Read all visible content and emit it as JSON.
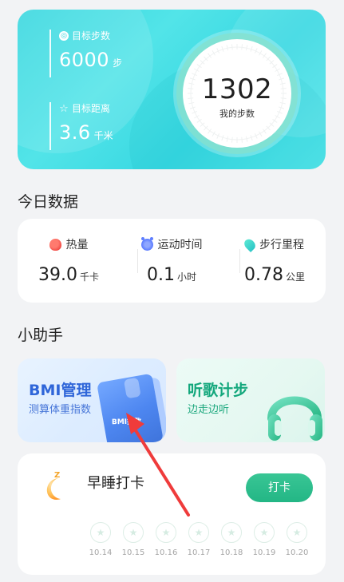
{
  "hero": {
    "goal_steps_label": "目标步数",
    "goal_steps_value": "6000",
    "goal_steps_unit": "步",
    "goal_distance_label": "目标距离",
    "goal_distance_value": "3.6",
    "goal_distance_unit": "千米",
    "current_steps": "1302",
    "current_steps_label": "我的步数"
  },
  "today": {
    "title": "今日数据",
    "metrics": [
      {
        "label": "热量",
        "value": "39.0",
        "unit": "千卡"
      },
      {
        "label": "运动时间",
        "value": "0.1",
        "unit": "小时"
      },
      {
        "label": "步行里程",
        "value": "0.78",
        "unit": "公里"
      }
    ]
  },
  "helper": {
    "title": "小助手",
    "cards": [
      {
        "title": "BMI管理",
        "subtitle": "测算体重指数",
        "illustration_text": "BMI指数"
      },
      {
        "title": "听歌计步",
        "subtitle": "边走边听"
      }
    ]
  },
  "sleep": {
    "title": "早睡打卡",
    "button_label": "打卡",
    "dates": [
      "10.14",
      "10.15",
      "10.16",
      "10.17",
      "10.18",
      "10.19",
      "10.20"
    ]
  },
  "colors": {
    "hero": "#36d7df",
    "accent_green": "#23b685",
    "accent_blue": "#2f66d9"
  }
}
